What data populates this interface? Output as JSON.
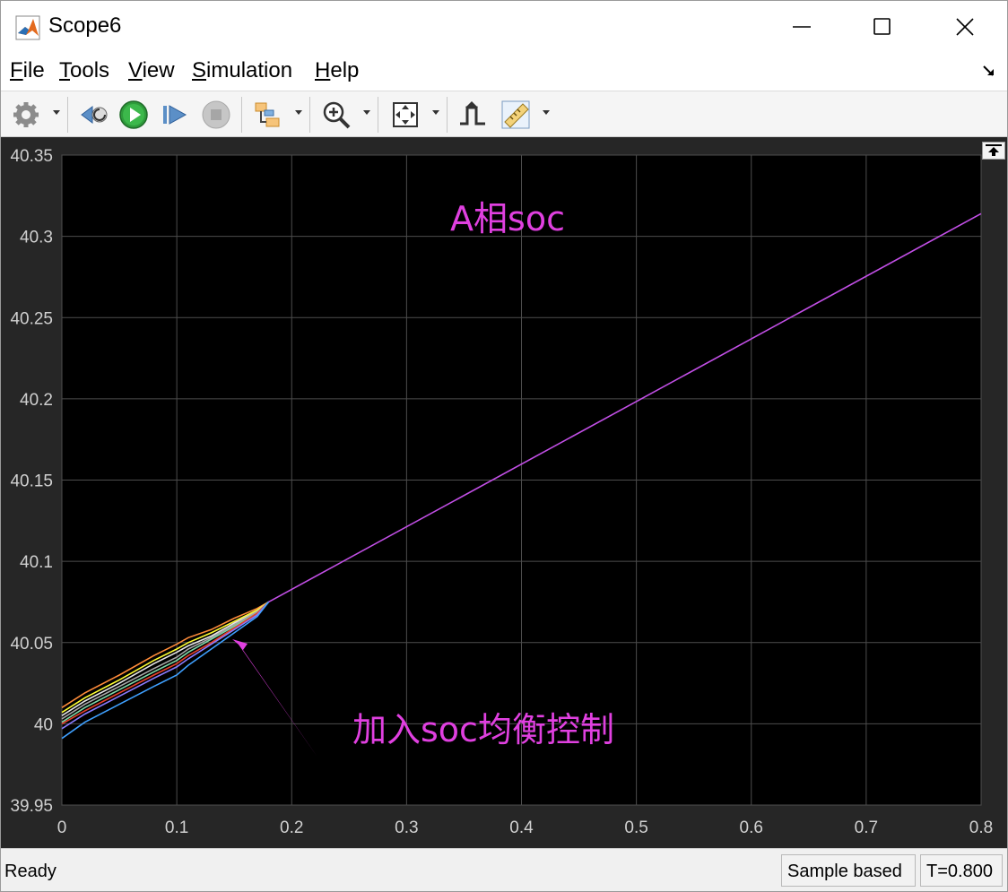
{
  "window": {
    "title": "Scope6"
  },
  "menu": [
    {
      "key": "F",
      "rest": "ile"
    },
    {
      "key": "T",
      "rest": "ools"
    },
    {
      "key": "V",
      "rest": "iew"
    },
    {
      "key": "S",
      "rest": "imulation"
    },
    {
      "key": "H",
      "rest": "elp"
    }
  ],
  "toolbar": {
    "icons": [
      "gear-icon",
      "step-back-icon",
      "run-icon",
      "step-forward-icon",
      "stop-icon",
      "signal-tracing-icon",
      "zoom-in-icon",
      "autoscale-icon",
      "triggers-icon",
      "measurements-icon"
    ]
  },
  "annotations": {
    "title": "A相soc",
    "callout": "加入soc均衡控制",
    "color": "#e040e0"
  },
  "status": {
    "text": "Ready",
    "mode": "Sample based",
    "time": "T=0.800"
  },
  "chart_data": {
    "type": "line",
    "xlim": [
      0,
      0.8
    ],
    "ylim": [
      39.95,
      40.35
    ],
    "xticks": [
      "0",
      "0.1",
      "0.2",
      "0.3",
      "0.4",
      "0.5",
      "0.6",
      "0.7",
      "0.8"
    ],
    "yticks": [
      "39.95",
      "40",
      "40.05",
      "40.1",
      "40.15",
      "40.2",
      "40.25",
      "40.3",
      "40.35"
    ],
    "grid": true,
    "background": "#000000",
    "merged": {
      "color": "#c24fe6",
      "x": [
        0.18,
        0.8
      ],
      "y": [
        40.075,
        40.314
      ]
    },
    "series": [
      {
        "color": "#ff8c3a",
        "x": [
          0,
          0.02,
          0.05,
          0.08,
          0.1,
          0.11,
          0.13,
          0.15,
          0.17,
          0.18
        ],
        "y": [
          40.01,
          40.019,
          40.03,
          40.042,
          40.049,
          40.053,
          40.058,
          40.065,
          40.071,
          40.075
        ]
      },
      {
        "color": "#ffff33",
        "x": [
          0,
          0.02,
          0.05,
          0.08,
          0.1,
          0.11,
          0.13,
          0.15,
          0.17,
          0.18
        ],
        "y": [
          40.007,
          40.016,
          40.027,
          40.039,
          40.046,
          40.05,
          40.056,
          40.063,
          40.07,
          40.075
        ]
      },
      {
        "color": "#e6e6e6",
        "x": [
          0,
          0.02,
          0.05,
          0.08,
          0.1,
          0.11,
          0.13,
          0.15,
          0.17,
          0.18
        ],
        "y": [
          40.005,
          40.014,
          40.025,
          40.037,
          40.044,
          40.048,
          40.054,
          40.062,
          40.069,
          40.075
        ]
      },
      {
        "color": "#a8a8a8",
        "x": [
          0,
          0.02,
          0.05,
          0.08,
          0.1,
          0.11,
          0.13,
          0.15,
          0.17,
          0.18
        ],
        "y": [
          40.003,
          40.012,
          40.023,
          40.034,
          40.041,
          40.046,
          40.053,
          40.061,
          40.069,
          40.075
        ]
      },
      {
        "color": "#7fd8a8",
        "x": [
          0,
          0.02,
          0.05,
          0.08,
          0.1,
          0.11,
          0.13,
          0.15,
          0.17,
          0.18
        ],
        "y": [
          40.001,
          40.01,
          40.021,
          40.032,
          40.039,
          40.044,
          40.052,
          40.06,
          40.068,
          40.075
        ]
      },
      {
        "color": "#e8402a",
        "x": [
          0,
          0.02,
          0.05,
          0.08,
          0.1,
          0.11,
          0.13,
          0.15,
          0.17,
          0.18
        ],
        "y": [
          40.0,
          40.008,
          40.019,
          40.03,
          40.037,
          40.042,
          40.05,
          40.059,
          40.068,
          40.075
        ]
      },
      {
        "color": "#8a7cff",
        "x": [
          0,
          0.02,
          0.05,
          0.08,
          0.1,
          0.11,
          0.13,
          0.15,
          0.17,
          0.18
        ],
        "y": [
          39.997,
          40.006,
          40.017,
          40.028,
          40.035,
          40.04,
          40.049,
          40.058,
          40.067,
          40.075
        ]
      },
      {
        "color": "#3fa0ff",
        "x": [
          0,
          0.02,
          0.05,
          0.08,
          0.1,
          0.11,
          0.13,
          0.15,
          0.17,
          0.18
        ],
        "y": [
          39.991,
          40.001,
          40.012,
          40.023,
          40.03,
          40.036,
          40.046,
          40.056,
          40.066,
          40.075
        ]
      }
    ]
  }
}
